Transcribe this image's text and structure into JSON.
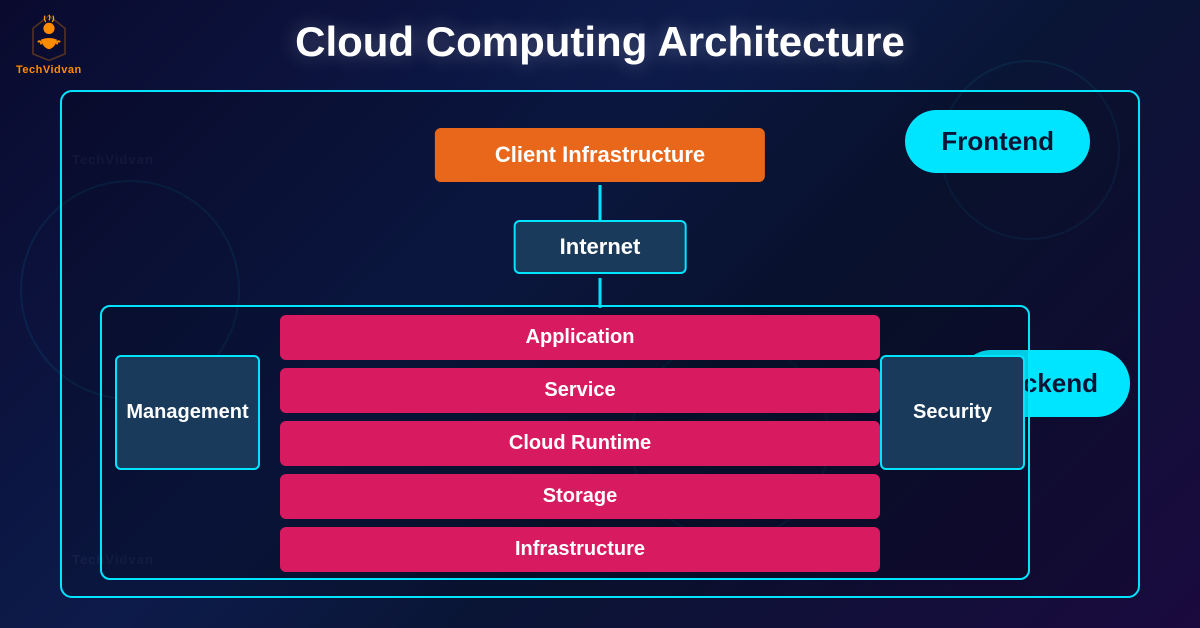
{
  "title": "Cloud Computing Architecture",
  "logo": {
    "text": "TechVidvan"
  },
  "diagram": {
    "frontend_label": "Frontend",
    "backend_label": "Backend",
    "client_infra": "Client Infrastructure",
    "internet": "Internet",
    "management": "Management",
    "security": "Security",
    "stack": [
      "Application",
      "Service",
      "Cloud Runtime",
      "Storage",
      "Infrastructure"
    ]
  }
}
